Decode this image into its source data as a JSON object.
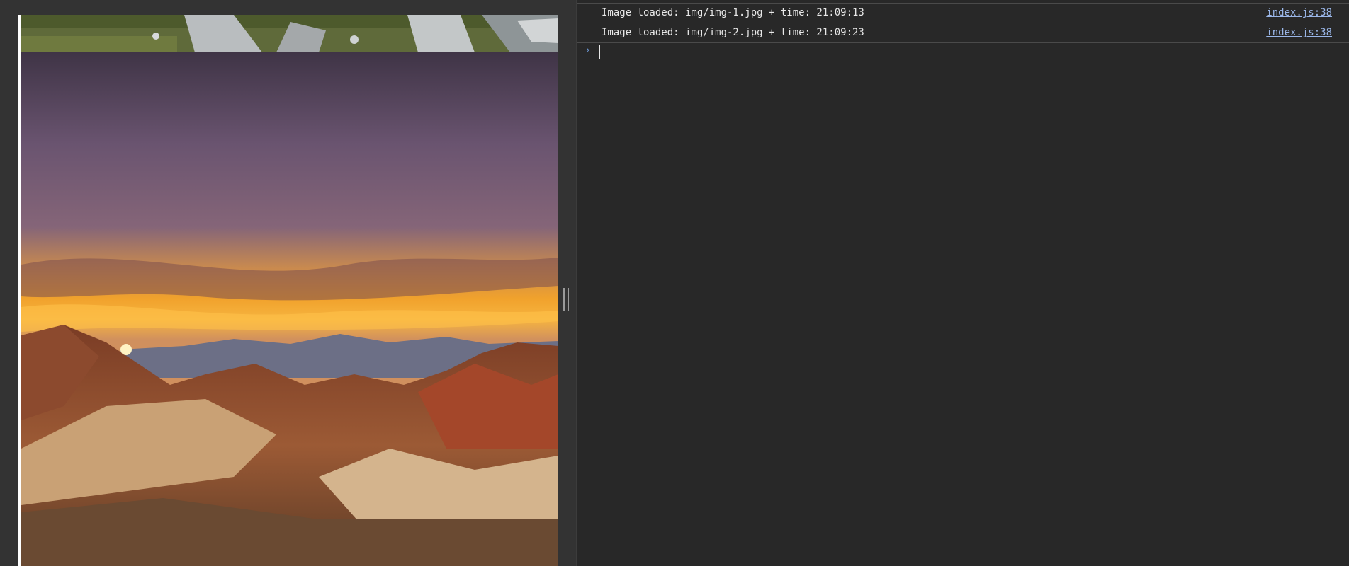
{
  "images": [
    {
      "name": "mountain-meadow-photo",
      "alt": "img/img-1.jpg"
    },
    {
      "name": "desert-sunset-photo",
      "alt": "img/img-2.jpg"
    }
  ],
  "console": {
    "logs": [
      {
        "message": "Image loaded: img/img-1.jpg + time: 21:09:13",
        "source": "index.js:38"
      },
      {
        "message": "Image loaded: img/img-2.jpg + time: 21:09:23",
        "source": "index.js:38"
      }
    ],
    "prompt_icon": "chevron-right-icon",
    "prompt_glyph": "›"
  },
  "colors": {
    "console_bg": "#282828",
    "link": "#9ab6e8",
    "prompt": "#6e9bd9"
  }
}
